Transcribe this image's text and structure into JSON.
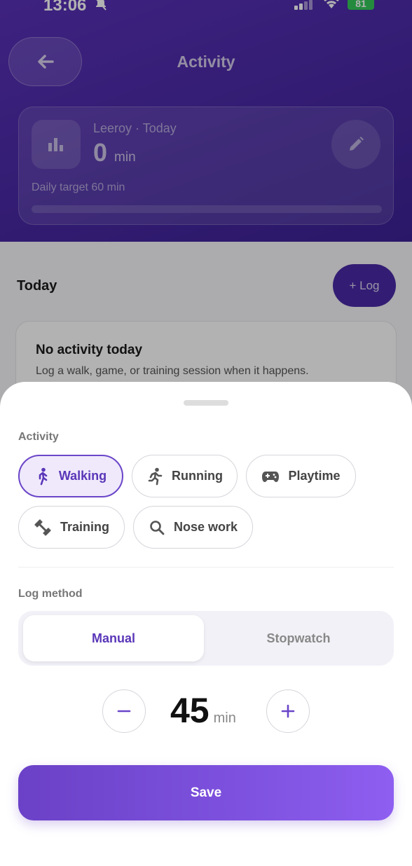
{
  "status_bar": {
    "time": "13:06",
    "battery": "81"
  },
  "header": {
    "title": "Activity"
  },
  "summary": {
    "subtitle": "Leeroy · Today",
    "value": "0",
    "unit": "min",
    "target_label": "Daily target 60 min",
    "progress": 0
  },
  "today": {
    "title": "Today",
    "log_button": "+ Log",
    "empty_title": "No activity today",
    "empty_desc": "Log a walk, game, or training session when it happens."
  },
  "sheet": {
    "activity_label": "Activity",
    "activities": [
      {
        "label": "Walking",
        "icon": "walking-icon",
        "selected": true
      },
      {
        "label": "Running",
        "icon": "running-icon",
        "selected": false
      },
      {
        "label": "Playtime",
        "icon": "gamepad-icon",
        "selected": false
      },
      {
        "label": "Training",
        "icon": "dumbbell-icon",
        "selected": false
      },
      {
        "label": "Nose work",
        "icon": "search-icon",
        "selected": false
      }
    ],
    "log_method_label": "Log method",
    "methods": [
      {
        "label": "Manual",
        "selected": true
      },
      {
        "label": "Stopwatch",
        "selected": false
      }
    ],
    "duration": {
      "value": "45",
      "unit": "min"
    },
    "save_label": "Save"
  },
  "colors": {
    "accent": "#6a45c9",
    "header": "#4a2aa6",
    "battery": "#34c759"
  }
}
